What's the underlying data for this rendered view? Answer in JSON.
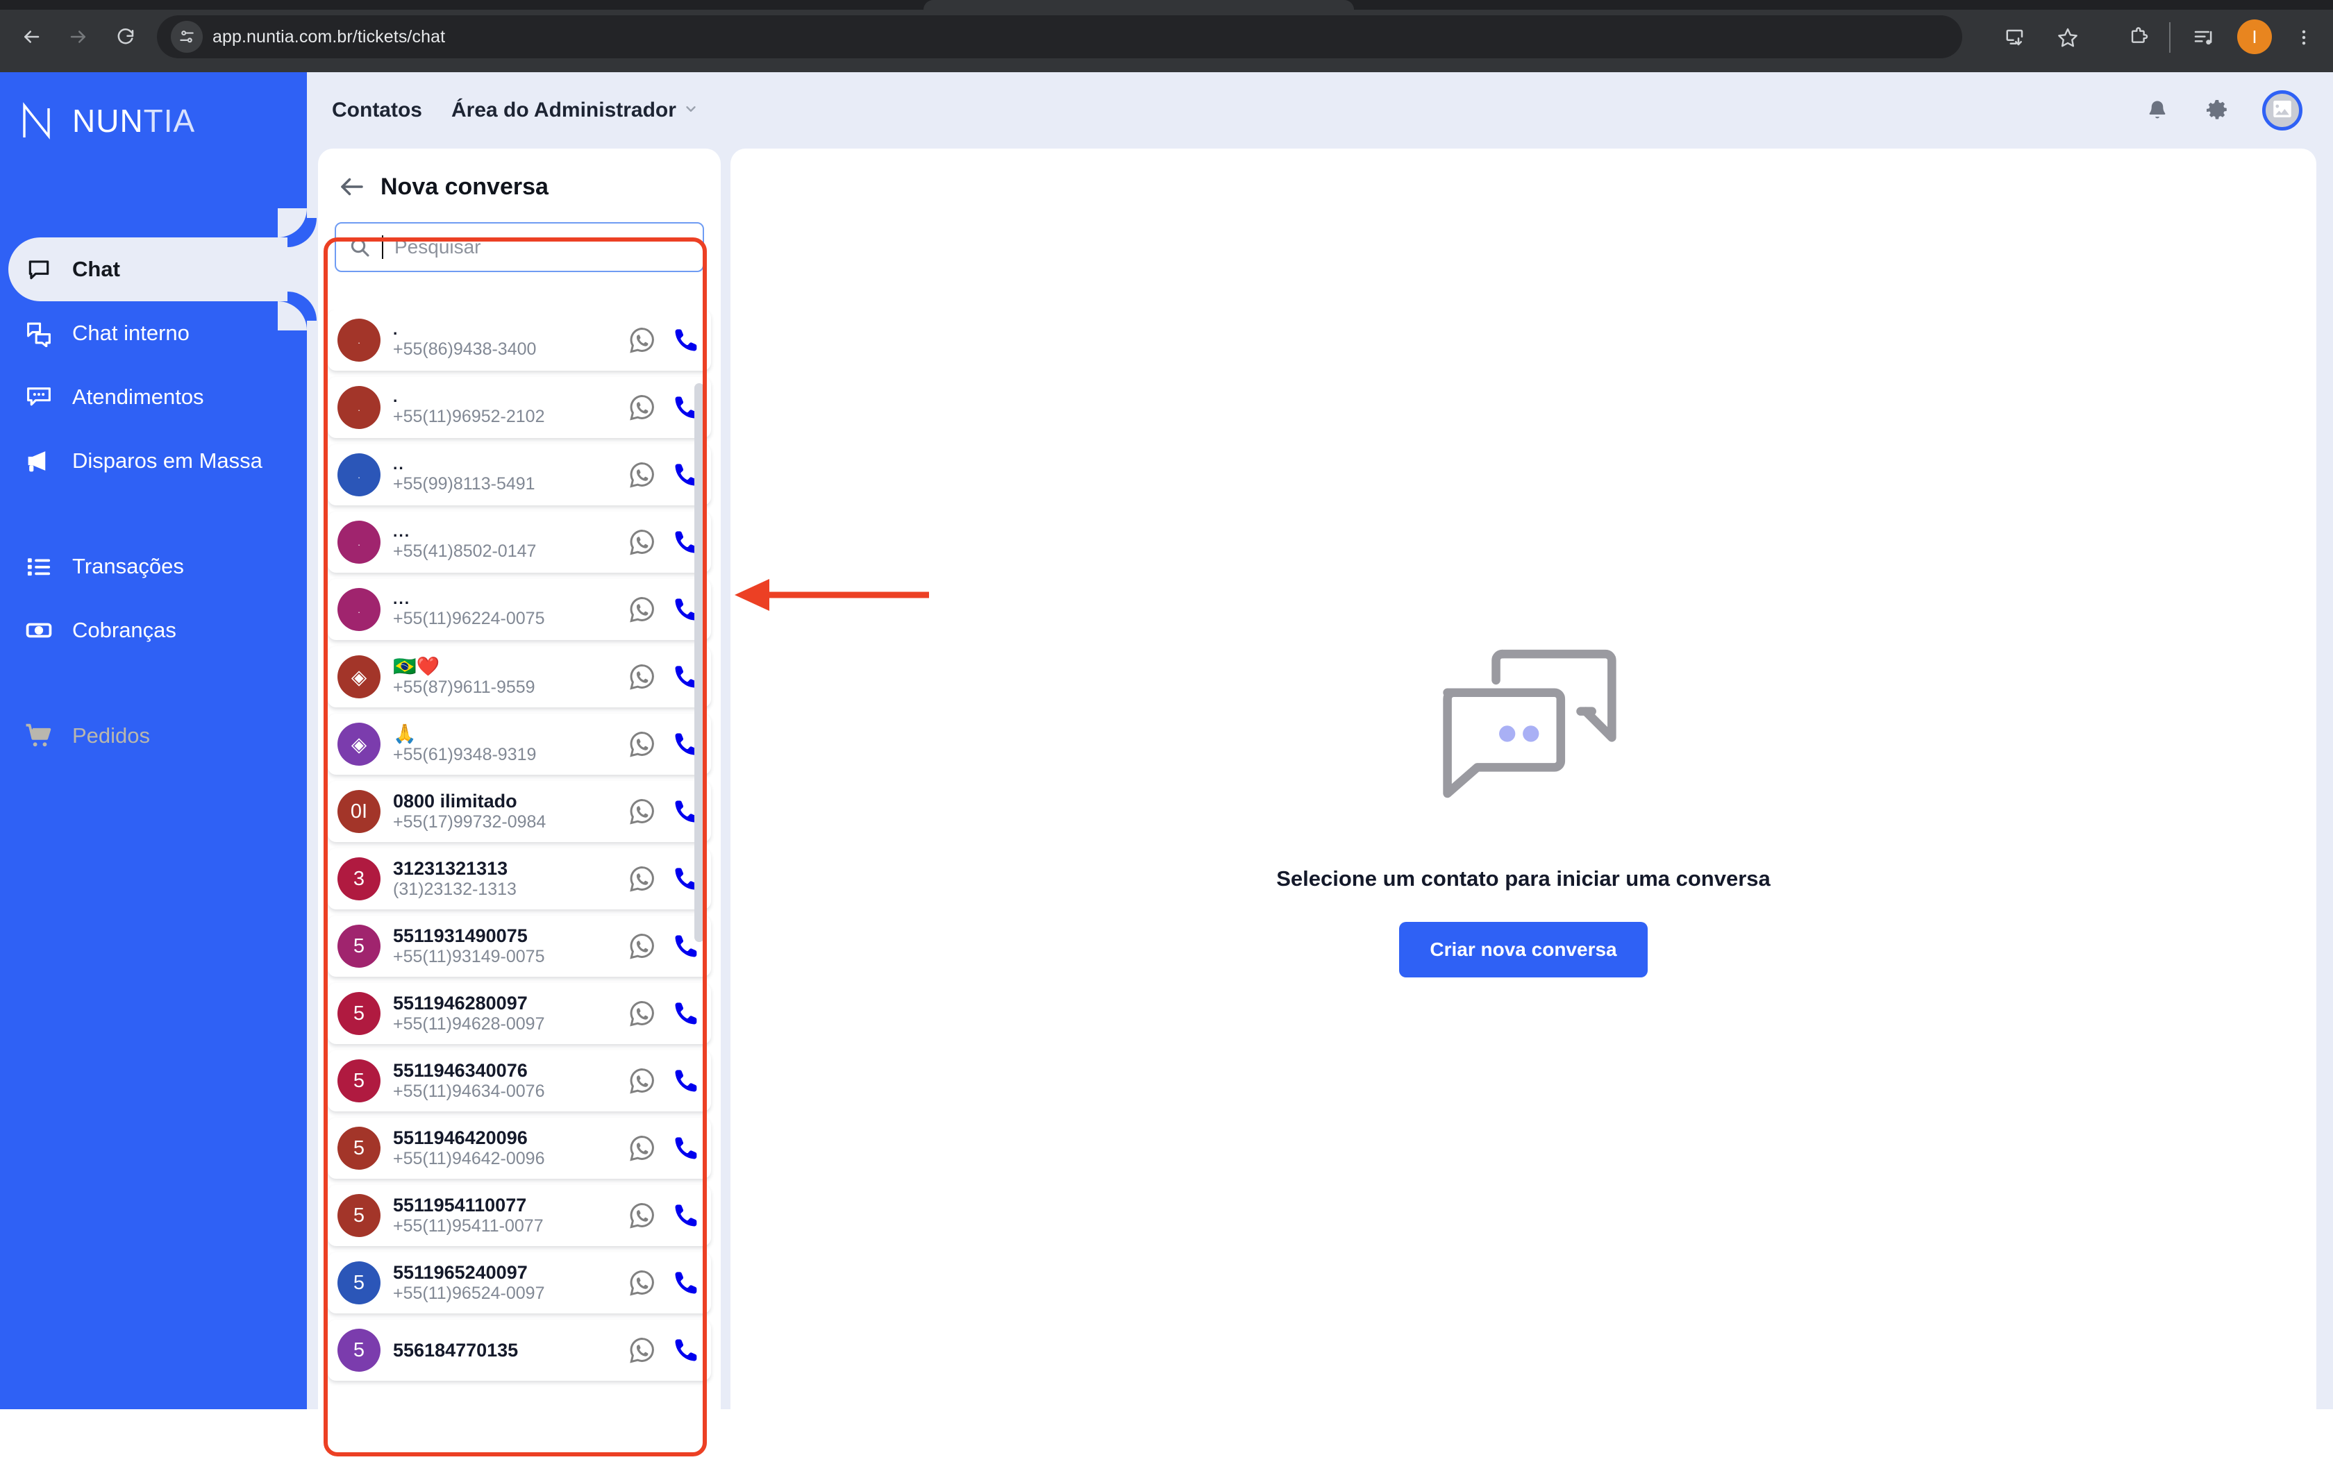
{
  "browser": {
    "url": "app.nuntia.com.br/tickets/chat",
    "back_icon": "back-arrow-icon",
    "forward_icon": "forward-arrow-icon",
    "reload_icon": "reload-icon",
    "site_info_icon": "site-settings-icon",
    "install_icon": "install-app-icon",
    "bookmark_icon": "star-icon",
    "extensions_icon": "extensions-puzzle-icon",
    "media_icon": "media-control-icon",
    "profile_initial": "I",
    "menu_icon": "three-dot-menu-icon"
  },
  "sidebar": {
    "brand": "NUN",
    "brand_suffix": "TIA",
    "items": [
      {
        "label": "Chat",
        "icon": "chat-bubble-icon",
        "active": true,
        "disabled": false
      },
      {
        "label": "Chat interno",
        "icon": "two-bubbles-icon",
        "active": false,
        "disabled": false
      },
      {
        "label": "Atendimentos",
        "icon": "bubble-dots-icon",
        "active": false,
        "disabled": false
      },
      {
        "label": "Disparos em Massa",
        "icon": "megaphone-icon",
        "active": false,
        "disabled": false
      },
      {
        "label": "Transações",
        "icon": "list-icon",
        "active": false,
        "disabled": false
      },
      {
        "label": "Cobranças",
        "icon": "banknote-icon",
        "active": false,
        "disabled": false
      },
      {
        "label": "Pedidos",
        "icon": "shopping-cart-icon",
        "active": false,
        "disabled": true
      }
    ]
  },
  "header": {
    "links": [
      {
        "label": "Contatos",
        "caret": false
      },
      {
        "label": "Área do Administrador",
        "caret": true
      }
    ],
    "notifications_icon": "bell-icon",
    "settings_icon": "gear-icon",
    "avatar_icon": "image-placeholder-icon"
  },
  "contact_panel": {
    "back_icon": "back-arrow-icon",
    "title": "Nova conversa",
    "search": {
      "placeholder": "Pesquisar",
      "value": "",
      "icon": "search-icon"
    },
    "whatsapp_icon": "whatsapp-icon",
    "call_icon": "phone-icon",
    "contacts": [
      {
        "name": ".",
        "phone": "+55(86)9438-3400",
        "avatar_label": ".",
        "avatar_color": "#A33529",
        "avatar_style": "tiny"
      },
      {
        "name": ".",
        "phone": "+55(11)96952-2102",
        "avatar_label": ".",
        "avatar_color": "#A33529",
        "avatar_style": "tiny"
      },
      {
        "name": "..",
        "phone": "+55(99)8113-5491",
        "avatar_label": ".",
        "avatar_color": "#2B56B8",
        "avatar_style": "tiny"
      },
      {
        "name": "...",
        "phone": "+55(41)8502-0147",
        "avatar_label": ".",
        "avatar_color": "#A0246E",
        "avatar_style": "tiny"
      },
      {
        "name": "...",
        "phone": "+55(11)96224-0075",
        "avatar_label": ".",
        "avatar_color": "#A0246E",
        "avatar_style": "tiny"
      },
      {
        "name": "🇧🇷❤️",
        "phone": "+55(87)9611-9559",
        "avatar_label": "◈",
        "avatar_color": "#A33529",
        "avatar_style": "normal"
      },
      {
        "name": "🙏",
        "phone": "+55(61)9348-9319",
        "avatar_label": "◈",
        "avatar_color": "#7B3CAD",
        "avatar_style": "normal"
      },
      {
        "name": "0800 ilimitado",
        "phone": "+55(17)99732-0984",
        "avatar_label": "0I",
        "avatar_color": "#A33529",
        "avatar_style": "normal"
      },
      {
        "name": "31231321313",
        "phone": "(31)23132-1313",
        "avatar_label": "3",
        "avatar_color": "#B01A40",
        "avatar_style": "normal"
      },
      {
        "name": "5511931490075",
        "phone": "+55(11)93149-0075",
        "avatar_label": "5",
        "avatar_color": "#A0246E",
        "avatar_style": "normal"
      },
      {
        "name": "5511946280097",
        "phone": "+55(11)94628-0097",
        "avatar_label": "5",
        "avatar_color": "#B01A40",
        "avatar_style": "normal"
      },
      {
        "name": "5511946340076",
        "phone": "+55(11)94634-0076",
        "avatar_label": "5",
        "avatar_color": "#B01A40",
        "avatar_style": "normal"
      },
      {
        "name": "5511946420096",
        "phone": "+55(11)94642-0096",
        "avatar_label": "5",
        "avatar_color": "#A33529",
        "avatar_style": "normal"
      },
      {
        "name": "5511954110077",
        "phone": "+55(11)95411-0077",
        "avatar_label": "5",
        "avatar_color": "#A33529",
        "avatar_style": "normal"
      },
      {
        "name": "5511965240097",
        "phone": "+55(11)96524-0097",
        "avatar_label": "5",
        "avatar_color": "#2B56B8",
        "avatar_style": "normal"
      },
      {
        "name": "556184770135",
        "phone": "",
        "avatar_label": "5",
        "avatar_color": "#7B3CAD",
        "avatar_style": "normal"
      }
    ]
  },
  "main": {
    "empty_icon": "two-chat-bubbles-icon",
    "empty_title": "Selecione um contato para iniciar uma conversa",
    "new_chat_label": "Criar nova conversa"
  },
  "annotations": {
    "box_color": "#EC4024",
    "arrow_color": "#EC4024",
    "arrow_icon": "left-arrow-annotation"
  },
  "colors": {
    "brand_blue": "#2F61F5",
    "app_bg": "#E8ECF7",
    "panel_white": "#FFFFFF"
  }
}
